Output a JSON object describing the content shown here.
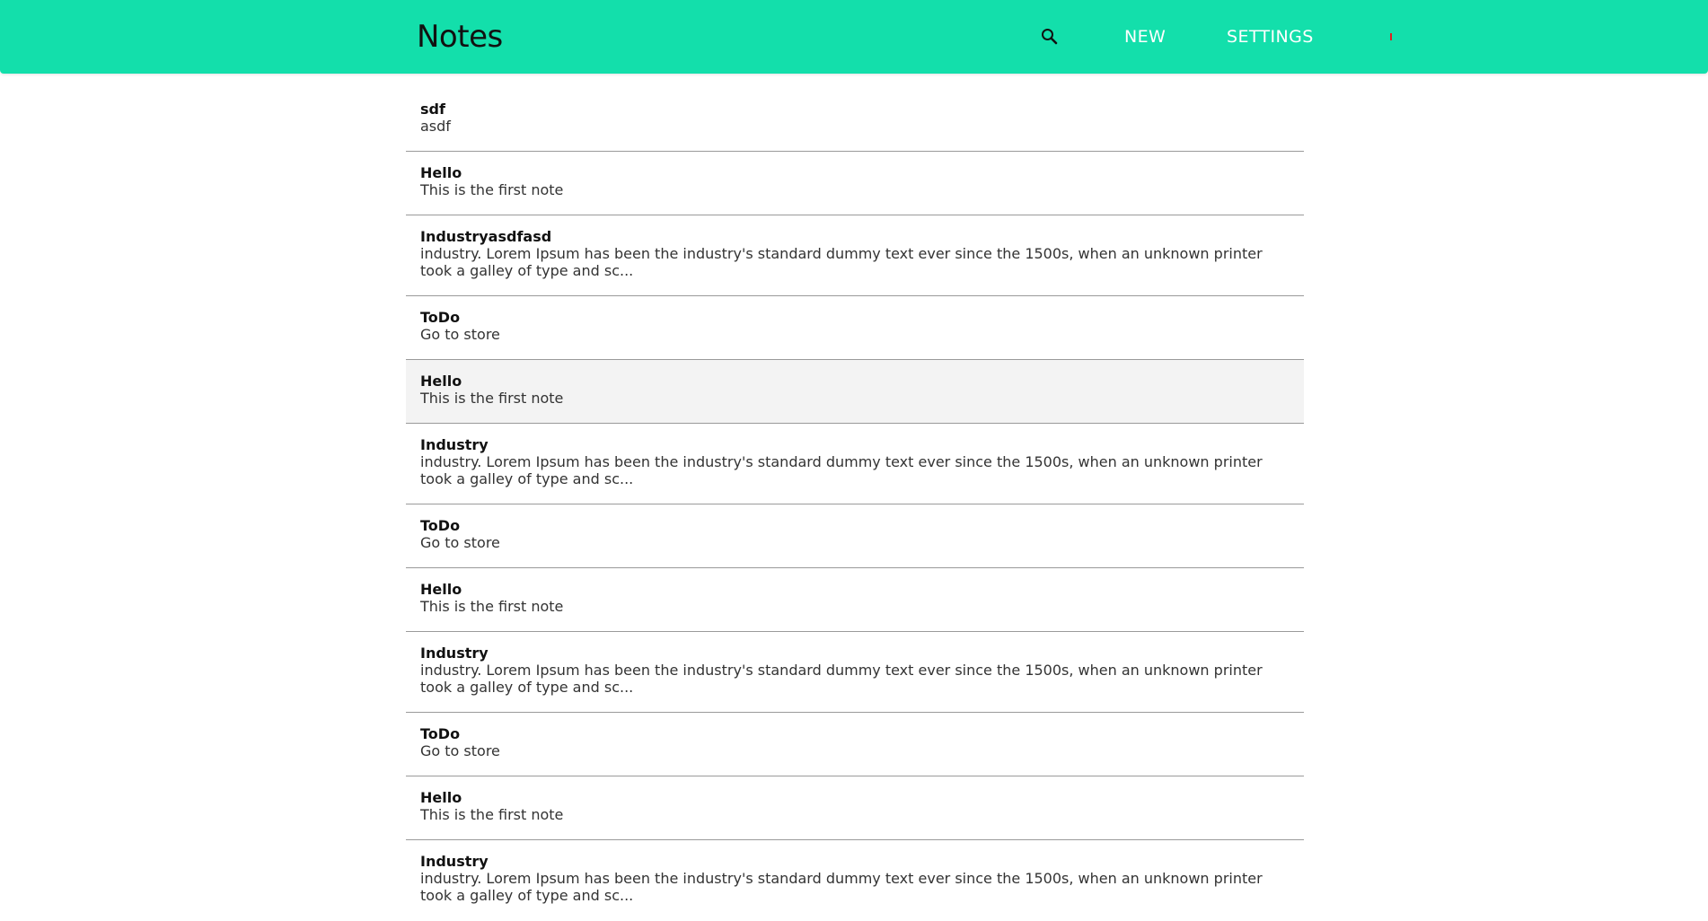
{
  "colors": {
    "appbar": "#13dfab",
    "highlight_row": "#f3f3f3",
    "divider": "#9a9a9a",
    "status_indicator": "#e02020"
  },
  "header": {
    "title": "Notes",
    "search_icon": "search-icon",
    "nav": {
      "new_label": "NEW",
      "settings_label": "SETTINGS"
    }
  },
  "notes": [
    {
      "title": "sdf",
      "preview": "asdf"
    },
    {
      "title": "Hello",
      "preview": "This is the first note"
    },
    {
      "title": "Industryasdfasd",
      "preview": "industry. Lorem Ipsum has been the industry's standard dummy text ever since the 1500s, when an unknown printer took a galley of type and sc..."
    },
    {
      "title": "ToDo",
      "preview": "Go to store"
    },
    {
      "title": "Hello",
      "preview": "This is the first note"
    },
    {
      "title": "Industry",
      "preview": "industry. Lorem Ipsum has been the industry's standard dummy text ever since the 1500s, when an unknown printer took a galley of type and sc..."
    },
    {
      "title": "ToDo",
      "preview": "Go to store"
    },
    {
      "title": "Hello",
      "preview": "This is the first note"
    },
    {
      "title": "Industry",
      "preview": "industry. Lorem Ipsum has been the industry's standard dummy text ever since the 1500s, when an unknown printer took a galley of type and sc..."
    },
    {
      "title": "ToDo",
      "preview": "Go to store"
    },
    {
      "title": "Hello",
      "preview": "This is the first note"
    },
    {
      "title": "Industry",
      "preview": "industry. Lorem Ipsum has been the industry's standard dummy text ever since the 1500s, when an unknown printer took a galley of type and sc..."
    }
  ]
}
